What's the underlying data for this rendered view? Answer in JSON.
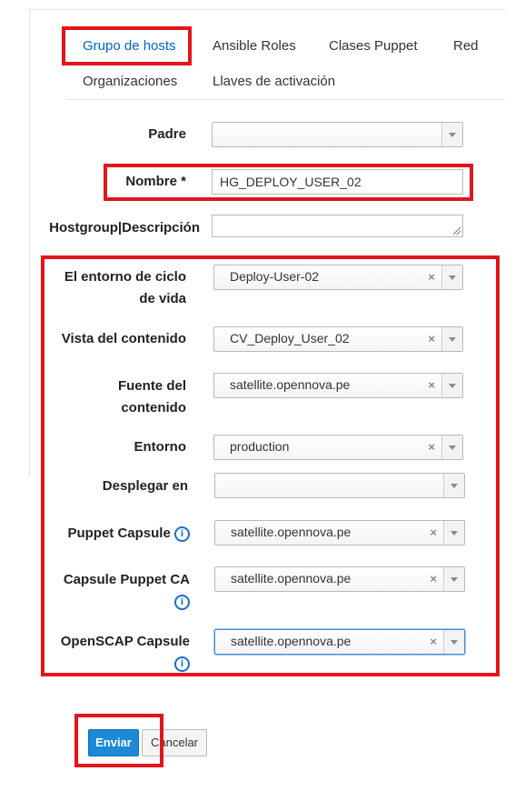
{
  "tabs": [
    {
      "label": "Grupo de hosts",
      "active": true
    },
    {
      "label": "Ansible Roles"
    },
    {
      "label": "Clases Puppet"
    },
    {
      "label": "Red"
    },
    {
      "label": "Organizaciones"
    },
    {
      "label": "Llaves de activación"
    }
  ],
  "form": {
    "parent": {
      "label": "Padre",
      "value": ""
    },
    "name": {
      "label": "Nombre *",
      "value": "HG_DEPLOY_USER_02"
    },
    "description": {
      "label": "Hostgroup|Descripción",
      "value": ""
    },
    "lifecycle_env": {
      "label_line1": "El entorno de ciclo",
      "label_line2": "de vida",
      "value": "Deploy-User-02"
    },
    "content_view": {
      "label": "Vista del contenido",
      "value": "CV_Deploy_User_02"
    },
    "content_source": {
      "label_line1": "Fuente del",
      "label_line2": "contenido",
      "value": "satellite.opennova.pe"
    },
    "environment": {
      "label": "Entorno",
      "value": "production"
    },
    "deploy_on": {
      "label": "Desplegar en",
      "value": ""
    },
    "puppet_capsule": {
      "label": "Puppet Capsule",
      "value": "satellite.opennova.pe"
    },
    "puppet_ca": {
      "label": "Capsule Puppet CA",
      "value": "satellite.opennova.pe"
    },
    "openscap_capsule": {
      "label": "OpenSCAP Capsule",
      "value": "satellite.opennova.pe"
    }
  },
  "icons": {
    "clear": "×",
    "info": "i"
  },
  "buttons": {
    "submit": "Enviar",
    "cancel": "Cancelar"
  },
  "colors": {
    "highlight": "#e3141c",
    "primary": "#1d8ad8",
    "link": "#0066cc"
  }
}
